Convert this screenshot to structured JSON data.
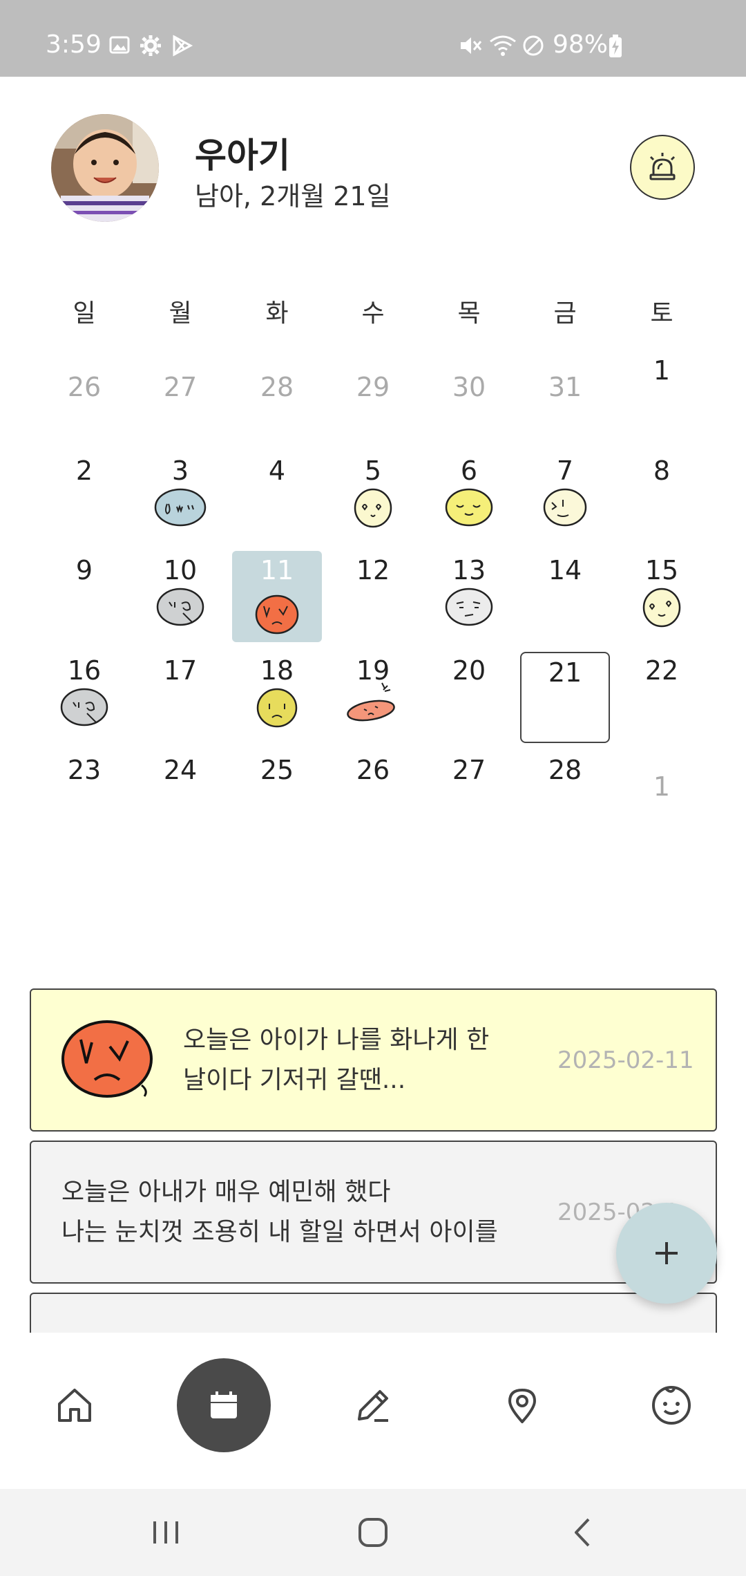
{
  "status_bar": {
    "time": "3:59",
    "battery": "98%"
  },
  "profile": {
    "name": "우아기",
    "info": "남아, 2개월 21일"
  },
  "calendar": {
    "weekdays": [
      "일",
      "월",
      "화",
      "수",
      "목",
      "금",
      "토"
    ],
    "row1": [
      "26",
      "27",
      "28",
      "29",
      "30",
      "31",
      "1"
    ],
    "row2": [
      "2",
      "3",
      "4",
      "5",
      "6",
      "7",
      "8"
    ],
    "row3": [
      "9",
      "10",
      "11",
      "12",
      "13",
      "14",
      "15"
    ],
    "row4": [
      "16",
      "17",
      "18",
      "19",
      "20",
      "21",
      "22"
    ],
    "row5": [
      "23",
      "24",
      "25",
      "26",
      "27",
      "28",
      "1"
    ]
  },
  "entries": [
    {
      "text_line1": "오늘은 아이가 나를 화나게 한",
      "text_line2": "날이다 기저귀 갈땐...",
      "date": "2025-02-11"
    },
    {
      "text_line1": "오늘은 아내가 매우 예민해 했다",
      "text_line2": "나는 눈치껏 조용히 내 할일 하면서 아이를",
      "date": "2025-02-1"
    }
  ],
  "colors": {
    "accent": "#c5dadd",
    "highlight": "#feffd1",
    "nav_active": "#4a4a4a",
    "angry": "#f26f45"
  },
  "icons": [
    "home-icon",
    "calendar-icon",
    "pencil-icon",
    "map-pin-icon",
    "baby-face-icon",
    "siren-icon",
    "plus-icon"
  ]
}
